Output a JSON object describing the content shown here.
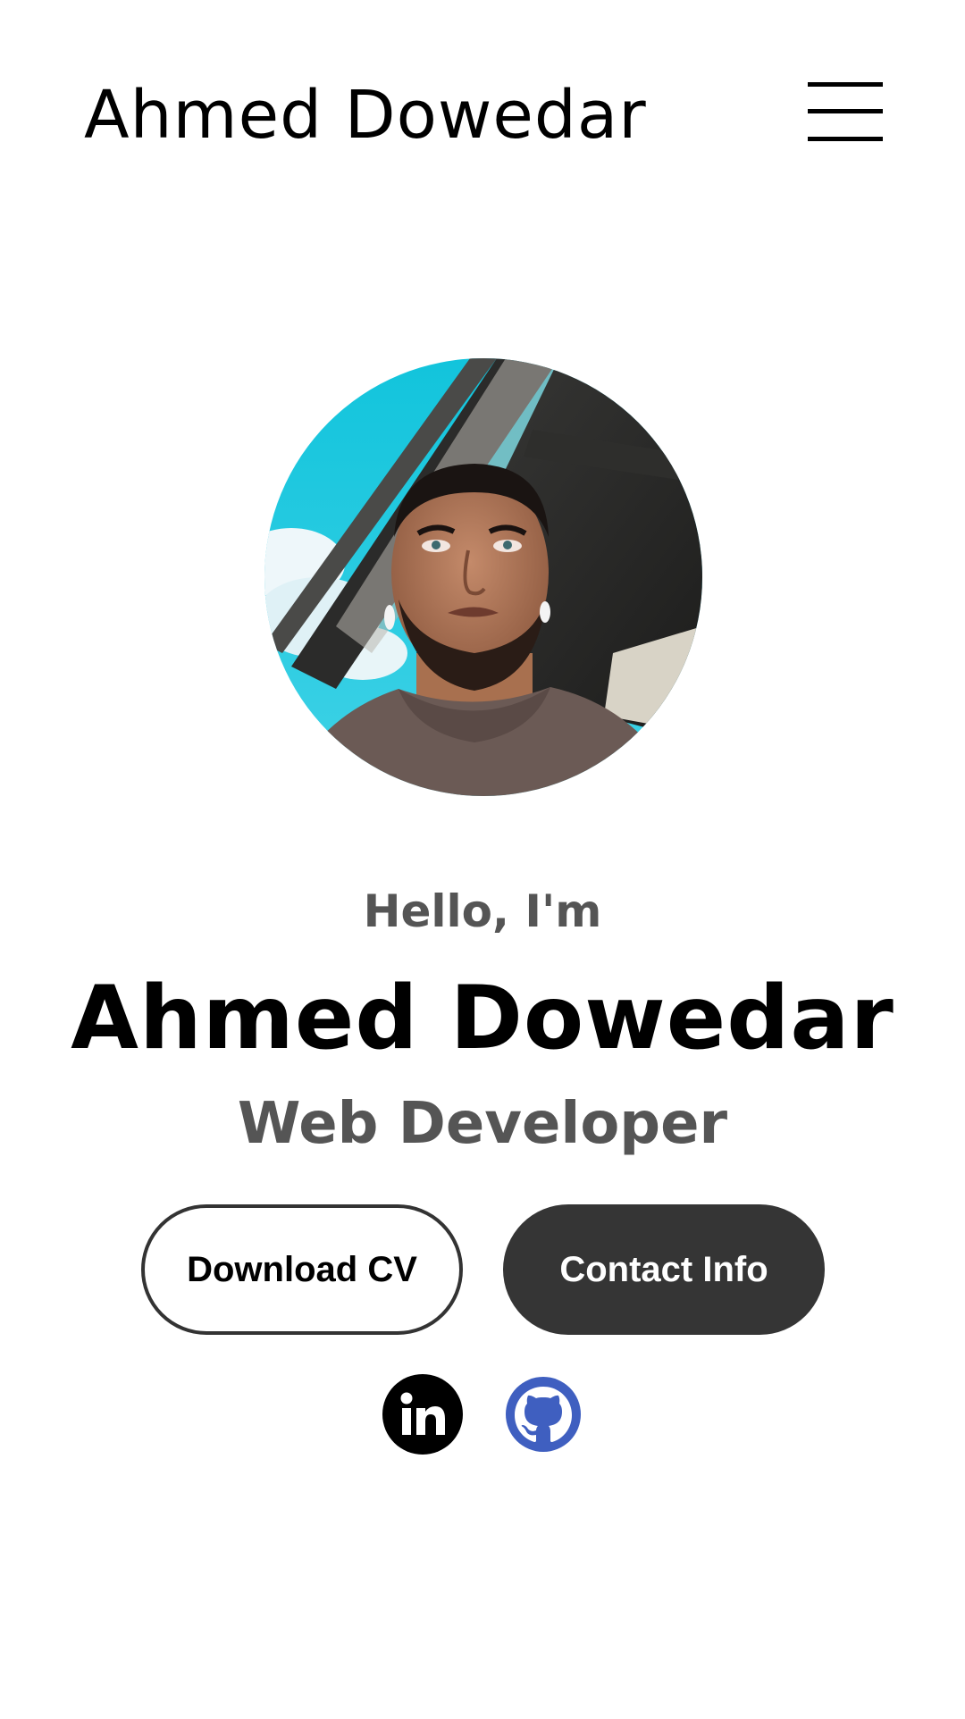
{
  "header": {
    "brand": "Ahmed Dowedar",
    "menu_icon": "hamburger-menu-icon"
  },
  "hero": {
    "avatar_icon": "profile-photo",
    "greeting": "Hello, I'm",
    "name": "Ahmed Dowedar",
    "role": "Web Developer"
  },
  "actions": {
    "download_cv": "Download CV",
    "contact_info": "Contact Info"
  },
  "social": {
    "linkedin_icon": "linkedin-icon",
    "github_icon": "github-icon"
  },
  "colors": {
    "text_primary": "#000000",
    "text_secondary": "#555555",
    "button_dark": "#353535",
    "button_outline_border": "#333333",
    "github_blue": "#3f5fc0"
  }
}
